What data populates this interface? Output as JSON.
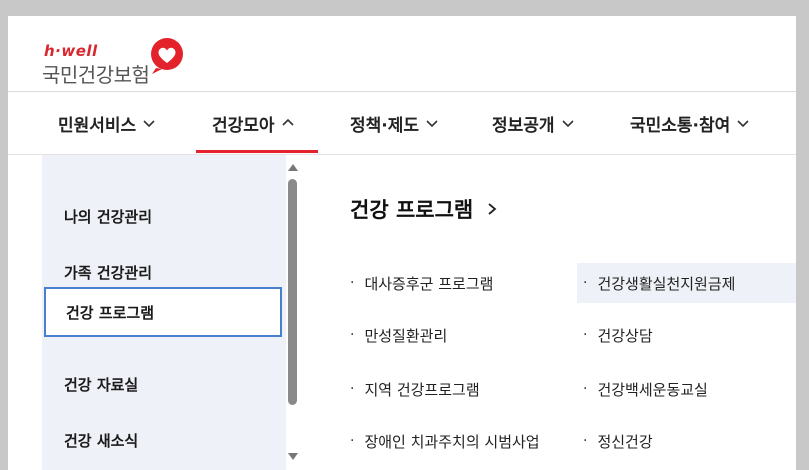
{
  "header": {
    "logo_small": "h·well",
    "logo_main": "국민건강보험"
  },
  "nav": {
    "items": [
      {
        "label": "민원서비스",
        "state": "collapsed"
      },
      {
        "label": "건강모아",
        "state": "expanded"
      },
      {
        "label": "정책·제도",
        "state": "collapsed"
      },
      {
        "label": "정보공개",
        "state": "collapsed"
      },
      {
        "label": "국민소통·참여",
        "state": "collapsed"
      }
    ],
    "accent_color": "#e3222b"
  },
  "sidebar": {
    "items": [
      {
        "label": "나의 건강관리"
      },
      {
        "label": "가족 건강관리"
      },
      {
        "label": "건강 프로그램"
      },
      {
        "label": "건강 자료실"
      },
      {
        "label": "건강 새소식"
      }
    ],
    "active_index": 2
  },
  "content": {
    "title": "건강 프로그램",
    "left_column": [
      {
        "label": "대사증후군 프로그램"
      },
      {
        "label": "만성질환관리"
      },
      {
        "label": "지역 건강프로그램"
      },
      {
        "label": "장애인 치과주치의 시범사업"
      }
    ],
    "right_column": [
      {
        "label": "건강생활실천지원금제"
      },
      {
        "label": "건강상담"
      },
      {
        "label": "건강백세운동교실"
      },
      {
        "label": "정신건강"
      }
    ]
  }
}
